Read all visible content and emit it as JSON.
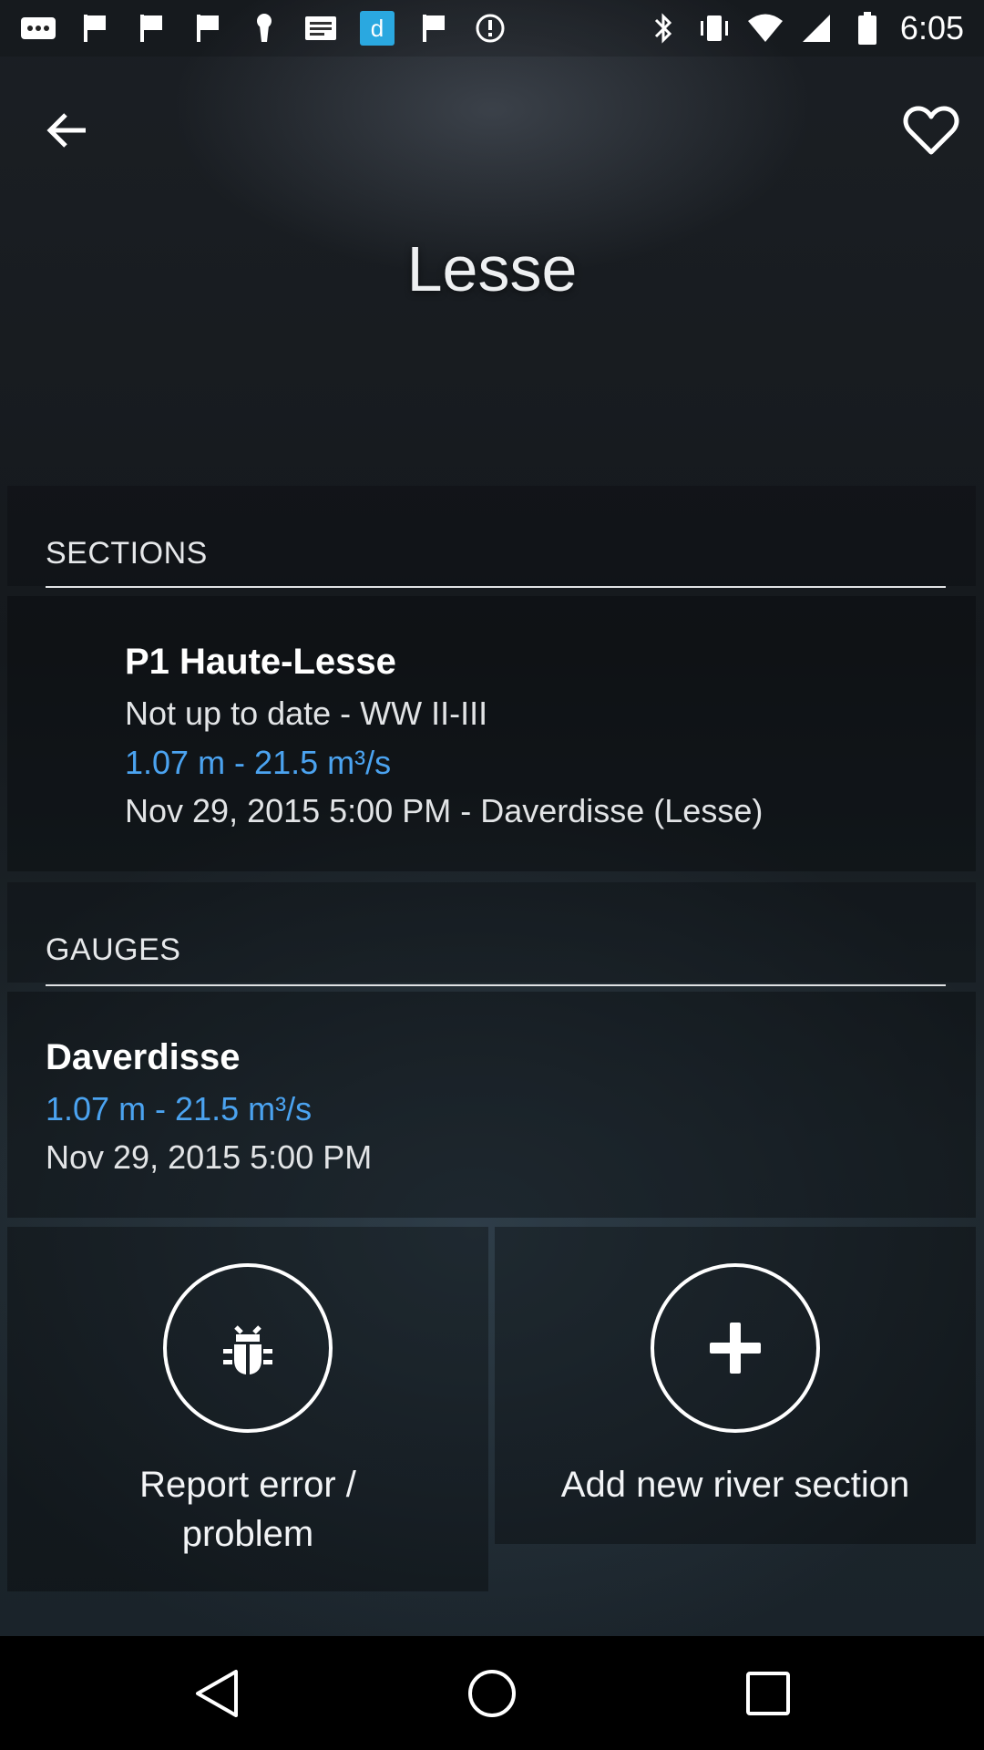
{
  "status_bar": {
    "time": "6:05",
    "left_icons": [
      "more-icon",
      "flag-icon",
      "flag-icon",
      "flag-icon",
      "keyhole-icon",
      "news-icon",
      "app-d-icon",
      "flag-icon",
      "info-circle-icon"
    ],
    "right_icons": [
      "bluetooth-icon",
      "vibrate-icon",
      "wifi-icon",
      "signal-icon",
      "battery-icon"
    ]
  },
  "header": {
    "title": "Lesse"
  },
  "sections": {
    "header": "SECTIONS",
    "items": [
      {
        "name": "P1 Haute-Lesse",
        "status": "Not up to date - WW II-III",
        "reading": "1.07 m - 21.5 m³/s",
        "timestamp": "Nov 29, 2015 5:00 PM - Daverdisse (Lesse)"
      }
    ]
  },
  "gauges": {
    "header": "GAUGES",
    "items": [
      {
        "name": "Daverdisse",
        "reading": "1.07 m - 21.5 m³/s",
        "timestamp": "Nov 29, 2015 5:00 PM"
      }
    ]
  },
  "actions": {
    "report": {
      "line1": "Report error /",
      "line2": "problem",
      "icon": "bug-icon"
    },
    "add": {
      "label": "Add new river section",
      "icon": "plus-icon"
    }
  },
  "colors": {
    "accent_blue": "#4ba3f0"
  }
}
